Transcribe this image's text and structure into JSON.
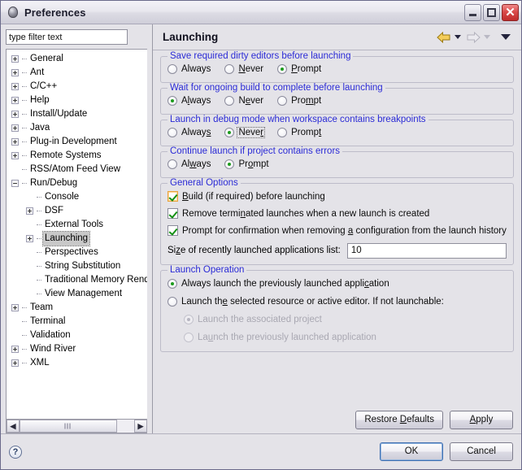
{
  "window": {
    "title": "Preferences",
    "icon": "eclipse-ball-icon",
    "minimize_label": "",
    "maximize_label": "",
    "close_label": "✕"
  },
  "sidebar": {
    "filter": {
      "value": "type filter text",
      "placeholder": "type filter text"
    },
    "items": [
      {
        "label": "General",
        "indent": 0,
        "twisty": "plus"
      },
      {
        "label": "Ant",
        "indent": 0,
        "twisty": "plus"
      },
      {
        "label": "C/C++",
        "indent": 0,
        "twisty": "plus"
      },
      {
        "label": "Help",
        "indent": 0,
        "twisty": "plus"
      },
      {
        "label": "Install/Update",
        "indent": 0,
        "twisty": "plus"
      },
      {
        "label": "Java",
        "indent": 0,
        "twisty": "plus"
      },
      {
        "label": "Plug-in Development",
        "indent": 0,
        "twisty": "plus"
      },
      {
        "label": "Remote Systems",
        "indent": 0,
        "twisty": "plus"
      },
      {
        "label": "RSS/Atom Feed View",
        "indent": 0,
        "twisty": "none"
      },
      {
        "label": "Run/Debug",
        "indent": 0,
        "twisty": "minus"
      },
      {
        "label": "Console",
        "indent": 1,
        "twisty": "none"
      },
      {
        "label": "DSF",
        "indent": 1,
        "twisty": "plus"
      },
      {
        "label": "External Tools",
        "indent": 1,
        "twisty": "none"
      },
      {
        "label": "Launching",
        "indent": 1,
        "twisty": "plus",
        "selected": true
      },
      {
        "label": "Perspectives",
        "indent": 1,
        "twisty": "none"
      },
      {
        "label": "String Substitution",
        "indent": 1,
        "twisty": "none"
      },
      {
        "label": "Traditional Memory Renderi",
        "indent": 1,
        "twisty": "none"
      },
      {
        "label": "View Management",
        "indent": 1,
        "twisty": "none"
      },
      {
        "label": "Team",
        "indent": 0,
        "twisty": "plus"
      },
      {
        "label": "Terminal",
        "indent": 0,
        "twisty": "none"
      },
      {
        "label": "Validation",
        "indent": 0,
        "twisty": "none"
      },
      {
        "label": "Wind River",
        "indent": 0,
        "twisty": "plus"
      },
      {
        "label": "XML",
        "indent": 0,
        "twisty": "plus"
      }
    ]
  },
  "pane": {
    "title": "Launching",
    "nav": {
      "back_icon": "back-arrow-icon",
      "back_enabled": true,
      "forward_icon": "forward-arrow-icon",
      "forward_enabled": false,
      "menu_icon": "view-menu-icon"
    }
  },
  "groups": {
    "save_dirty": {
      "legend": "Save required dirty editors before launching",
      "options": [
        {
          "label": "Always",
          "mnemonic": "",
          "selected": false
        },
        {
          "label": "Never",
          "mnemonic": "N",
          "selected": false
        },
        {
          "label": "Prompt",
          "mnemonic": "P",
          "selected": true
        }
      ]
    },
    "wait_build": {
      "legend": "Wait for ongoing build to complete before launching",
      "options": [
        {
          "label": "Always",
          "mnemonic": "l",
          "selected": true
        },
        {
          "label": "Never",
          "mnemonic": "e",
          "selected": false
        },
        {
          "label": "Prompt",
          "mnemonic": "m",
          "selected": false
        }
      ]
    },
    "debug_mode": {
      "legend": "Launch in debug mode when workspace contains breakpoints",
      "options": [
        {
          "label": "Always",
          "mnemonic": "s",
          "selected": false
        },
        {
          "label": "Never",
          "mnemonic": "r",
          "selected": true,
          "focused": true
        },
        {
          "label": "Prompt",
          "mnemonic": "t",
          "selected": false
        }
      ]
    },
    "continue_errors": {
      "legend": "Continue launch if project contains errors",
      "options": [
        {
          "label": "Always",
          "mnemonic": "w",
          "selected": false
        },
        {
          "label": "Prompt",
          "mnemonic": "o",
          "selected": true
        }
      ]
    },
    "general_options": {
      "legend": "General Options",
      "checkboxes": [
        {
          "label": "Build (if required) before launching",
          "checked": true,
          "hover": true
        },
        {
          "label": "Remove terminated launches when a new launch is created",
          "checked": true,
          "hover": false
        },
        {
          "label": "Prompt for confirmation when removing a configuration from the launch history",
          "checked": true,
          "hover": false
        }
      ],
      "size_field": {
        "label": "Size of recently launched applications list:",
        "value": "10"
      }
    },
    "launch_operation": {
      "legend": "Launch Operation",
      "options": [
        {
          "label": "Always launch the previously launched application",
          "selected": true,
          "disabled": false,
          "indent": false
        },
        {
          "label": "Launch the selected resource or active editor. If not launchable:",
          "selected": false,
          "disabled": false,
          "indent": false
        },
        {
          "label": "Launch the associated project",
          "selected": true,
          "disabled": true,
          "indent": true
        },
        {
          "label": "Launch the previously launched application",
          "selected": false,
          "disabled": true,
          "indent": true
        }
      ]
    }
  },
  "buttons": {
    "restore_defaults": "Restore Defaults",
    "apply": "Apply",
    "ok": "OK",
    "cancel": "Cancel"
  },
  "footer": {
    "help_icon": "help-icon",
    "help_glyph": "?"
  }
}
